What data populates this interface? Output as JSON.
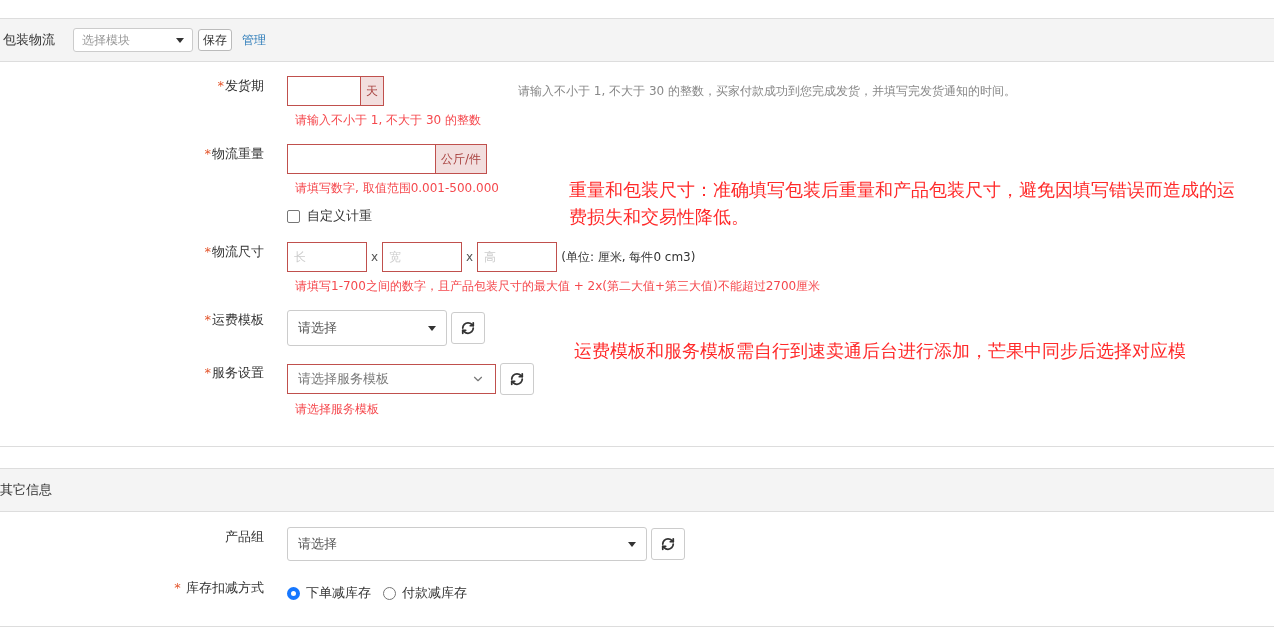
{
  "module_bar": {
    "title": "包装物流",
    "select": {
      "placeholder": "选择模块"
    },
    "save": "保存",
    "manage": "管理"
  },
  "shipping": {
    "fields": [
      {
        "kind": "unit-input",
        "mark": "*",
        "label": "发货期",
        "unit": "天",
        "invalid": true,
        "error": "请输入不小于 1, 不大于 30 的整数",
        "hint": "请输入不小于 1, 不大于 30 的整数，买家付款成功到您完成发货，并填写完发货通知的时间。"
      },
      {
        "kind": "unit-input",
        "mark": "*",
        "label": "物流重量",
        "unit": "公斤/件",
        "invalid": true,
        "error": "请填写数字, 取值范围0.001-500.000",
        "checkbox": {
          "label": "自定义计重",
          "checked": false
        }
      },
      {
        "kind": "dimensions",
        "mark": "*",
        "label": "物流尺寸",
        "inputs": [
          {
            "placeholder": "长"
          },
          {
            "separator": "x",
            "placeholder": "宽"
          },
          {
            "separator": "x",
            "placeholder": "高"
          }
        ],
        "invalid": true,
        "note": "(单位: 厘米, 每件0 cm3)",
        "error": "请填写1-700之间的数字，且产品包装尺寸的最大值 + 2x(第二大值+第三大值)不能超过2700厘米"
      },
      {
        "kind": "select",
        "mark": "*",
        "label": "运费模板",
        "value": "请选择",
        "invalid": false
      },
      {
        "kind": "native-select",
        "mark": "*",
        "label": "服务设置",
        "placeholder": "请选择服务模板",
        "invalid": true,
        "error": "请选择服务模板"
      }
    ],
    "annotations": [
      "重量和包装尺寸：准确填写包装后重量和产品包装尺寸，避免因填写错误而造成的运费损失和交易性降低。",
      "运费模板和服务模板需自行到速卖通后台进行添加，芒果中同步后选择对应模"
    ]
  },
  "other": {
    "title": "其它信息",
    "fields": [
      {
        "kind": "wide-select",
        "label": "产品组",
        "value": "请选择"
      },
      {
        "kind": "radios",
        "mark": "*",
        "label": "库存扣减方式",
        "options": [
          {
            "label": "下单减库存",
            "selected": true
          },
          {
            "label": "付款减库存",
            "selected": false
          }
        ]
      }
    ]
  }
}
